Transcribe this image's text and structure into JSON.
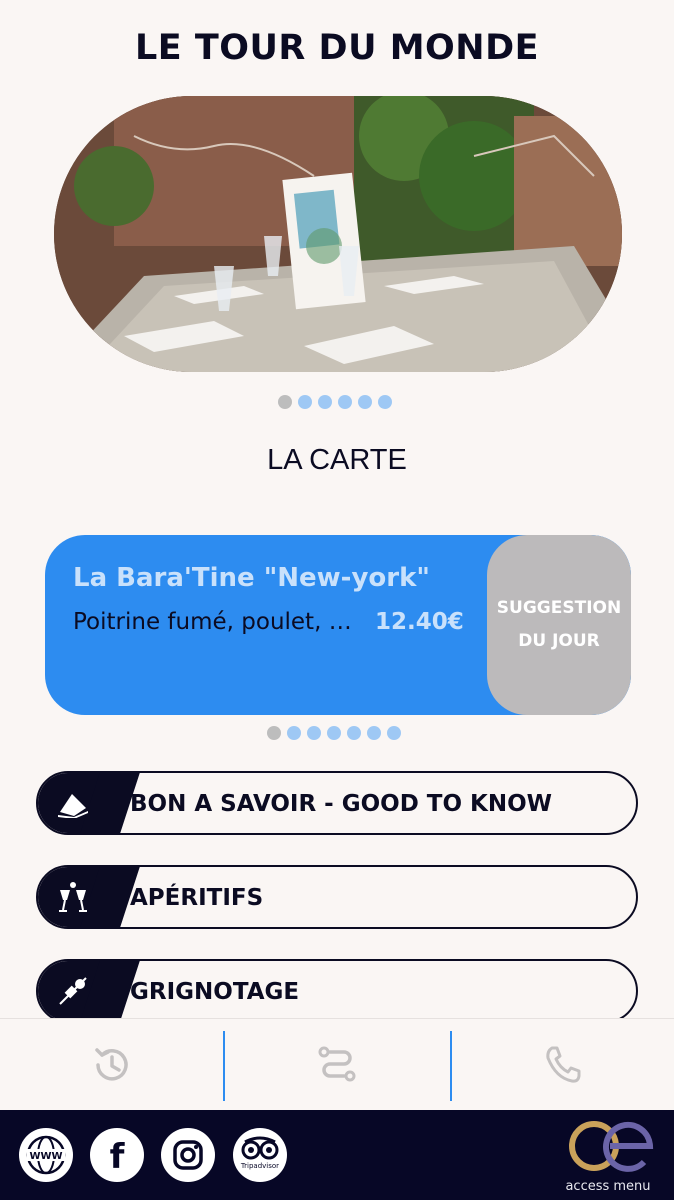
{
  "header": {
    "title": "LE TOUR DU MONDE"
  },
  "hero": {
    "slide_count": 6,
    "active_slide": 1
  },
  "section": {
    "title": "LA CARTE"
  },
  "suggestion": {
    "name": "La Bara'Tine \"New-york\"",
    "description": "Poitrine fumé, poulet, …",
    "price": "12.40€",
    "badge": "SUGGESTION DU JOUR",
    "slide_count": 7,
    "active_slide": 1
  },
  "menu": {
    "items": [
      {
        "label": "BON A SAVOIR - GOOD TO KNOW",
        "icon": "book-pages-icon"
      },
      {
        "label": "APÉRITIFS",
        "icon": "cheers-glasses-icon"
      },
      {
        "label": "GRIGNOTAGE",
        "icon": "skewer-icon"
      }
    ]
  },
  "action_bar": {
    "items": [
      {
        "icon": "clock-history-icon"
      },
      {
        "icon": "route-icon"
      },
      {
        "icon": "phone-icon"
      }
    ],
    "divider_color": "#2d8cf0"
  },
  "footer": {
    "social": [
      {
        "icon": "www-globe-icon",
        "label": "WWW"
      },
      {
        "icon": "facebook-icon",
        "label": "f"
      },
      {
        "icon": "instagram-icon"
      },
      {
        "icon": "tripadvisor-icon",
        "label": "Tripadvisor"
      }
    ],
    "brand": "access menu"
  },
  "colors": {
    "background": "#faf6f4",
    "navy": "#0b0b22",
    "accent_blue": "#2d8cf0",
    "dot_inactive": "#9ec8f4",
    "dot_active": "#bdbdbd",
    "badge_gray": "#bcbabb",
    "footer": "#070726",
    "brand_gold": "#c9a15a"
  }
}
